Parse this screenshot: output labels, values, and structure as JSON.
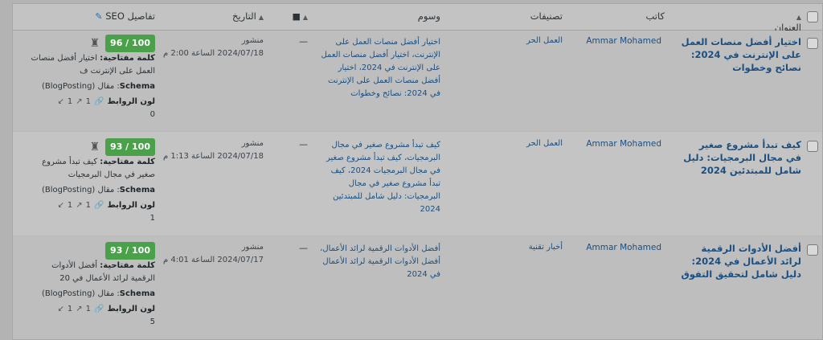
{
  "columns": {
    "title": "العنوان",
    "author": "كاتب",
    "categories": "تصنيفات",
    "tags": "وسوم",
    "date": "التاريخ",
    "seo": "تفاصيل SEO"
  },
  "labels": {
    "keyword": "كلمة مفتاحية:",
    "schema": "Schema",
    "schema_value": "مقال (BlogPosting)",
    "links": "لون الروابط"
  },
  "rows": [
    {
      "title": "اختيار أفضل منصات العمل على الإنترنت في 2024: نصائح وخطوات",
      "author": "Ammar Mohamed",
      "category": "العمل الحر",
      "tags": "اختيار أفضل منصات العمل على الإنترنت، اختيار أفضل منصات العمل على الإنترنت في 2024، اختيار أفضل منصات العمل على الإنترنت في 2024: نصائح وخطوات",
      "comments": "—",
      "status": "منشور",
      "date": "2024/07/18 الساعة 2:00 م",
      "score": "96 / 100",
      "keyword": "اختيار أفضل منصات العمل على الإنترنت ف",
      "internal": "1",
      "external": "1",
      "incoming": "0"
    },
    {
      "title": "كيف تبدأ مشروع صغير في مجال البرمجيات: دليل شامل للمبتدئين 2024",
      "author": "Ammar Mohamed",
      "category": "العمل الحر",
      "tags": "كيف تبدأ مشروع صغير في مجال البرمجيات، كيف تبدأ مشروع صغير في مجال البرمجيات 2024، كيف تبدأ مشروع صغير في مجال البرمجيات: دليل شامل للمبتدئين 2024",
      "comments": "—",
      "status": "منشور",
      "date": "2024/07/18 الساعة 1:13 م",
      "score": "93 / 100",
      "keyword": "كيف تبدأ مشروع صغير في مجال البرمجيات",
      "internal": "1",
      "external": "1",
      "incoming": "1"
    },
    {
      "title": "أفضل الأدوات الرقمية لرائد الأعمال في 2024: دليل شامل لتحقيق التفوق",
      "author": "Ammar Mohamed",
      "category": "أخبار تقنية",
      "tags": "أفضل الأدوات الرقمية لرائد الأعمال، أفضل الأدوات الرقمية لرائد الأعمال في 2024",
      "comments": "—",
      "status": "منشور",
      "date": "2024/07/17 الساعة 4:01 م",
      "score": "93 / 100",
      "keyword": "أفضل الأدوات الرقمية لرائد الأعمال في 20",
      "internal": "1",
      "external": "1",
      "incoming": "5"
    }
  ]
}
